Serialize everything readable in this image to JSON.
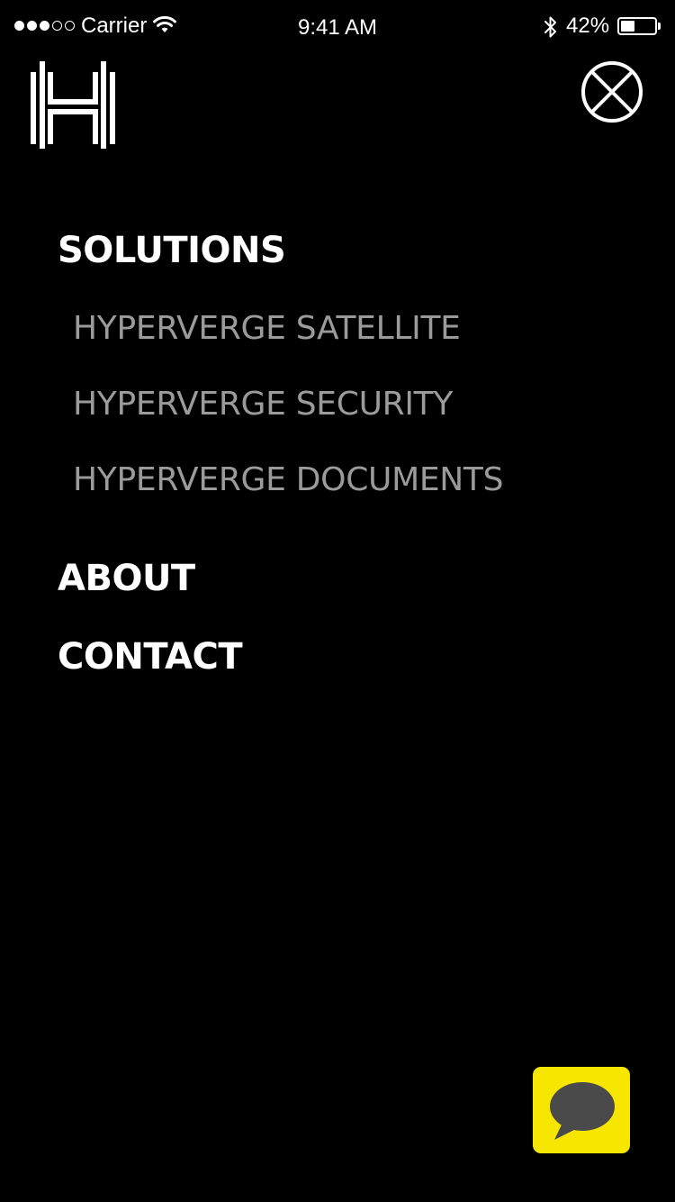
{
  "status_bar": {
    "carrier": "Carrier",
    "time": "9:41 AM",
    "battery_percent": "42%",
    "battery_level": 0.42,
    "signal_bars": 3,
    "signal_max": 5
  },
  "header": {
    "logo_icon": "hyperverge-h-logo",
    "close_icon": "close-circle-x-icon"
  },
  "menu": {
    "solutions": {
      "label": "SOLUTIONS",
      "items": [
        {
          "label": "HYPERVERGE SATELLITE"
        },
        {
          "label": "HYPERVERGE SECURITY"
        },
        {
          "label": "HYPERVERGE DOCUMENTS"
        }
      ]
    },
    "about": {
      "label": "ABOUT"
    },
    "contact": {
      "label": "CONTACT"
    }
  },
  "chat": {
    "icon": "chat-bubble-icon",
    "background_color": "#f7e600",
    "bubble_color": "#4a4a4a"
  },
  "colors": {
    "background": "#000000",
    "heading": "#ffffff",
    "subitem": "#9b9b9b"
  }
}
